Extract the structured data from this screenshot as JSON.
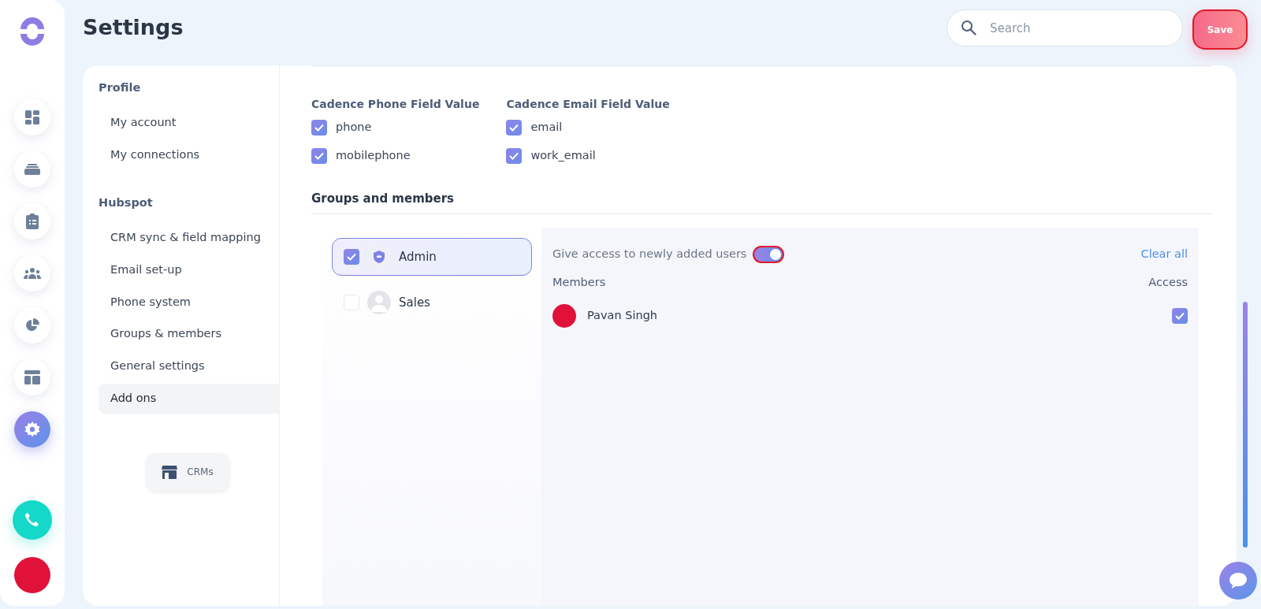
{
  "rail": {
    "items": [
      {
        "kind": "dashboard",
        "selected": false
      },
      {
        "kind": "inbox",
        "selected": false
      },
      {
        "kind": "clipboard",
        "selected": false
      },
      {
        "kind": "people",
        "selected": false
      },
      {
        "kind": "pie",
        "selected": false
      },
      {
        "kind": "layout",
        "selected": false
      },
      {
        "kind": "settings",
        "selected": true
      }
    ]
  },
  "header": {
    "title": "Settings",
    "search": {
      "placeholder": "Search"
    },
    "save_button": "Save"
  },
  "settings_nav": {
    "sections": [
      {
        "title": "Profile",
        "items": [
          {
            "label": "My account",
            "selected": false
          },
          {
            "label": "My connections",
            "selected": false
          }
        ]
      },
      {
        "title": "Hubspot",
        "items": [
          {
            "label": "CRM sync & field mapping",
            "selected": false
          },
          {
            "label": "Email set-up",
            "selected": false
          },
          {
            "label": "Phone system",
            "selected": false
          },
          {
            "label": "Groups & members",
            "selected": false
          },
          {
            "label": "General settings",
            "selected": false
          },
          {
            "label": "Add ons",
            "selected": true
          }
        ]
      }
    ],
    "crms_button": "CRMs"
  },
  "field_values": [
    {
      "title": "Cadence Phone Field Value",
      "options": [
        {
          "label": "phone",
          "checked": true
        },
        {
          "label": "mobilephone",
          "checked": true
        }
      ]
    },
    {
      "title": "Cadence Email Field Value",
      "options": [
        {
          "label": "email",
          "checked": true
        },
        {
          "label": "work_email",
          "checked": true
        }
      ]
    }
  ],
  "groups_section": {
    "title": "Groups and members",
    "groups": [
      {
        "name": "Admin",
        "kind": "shield",
        "checked": true,
        "selected": true
      },
      {
        "name": "Sales",
        "kind": "person",
        "checked": false,
        "selected": false
      }
    ],
    "access_toggle": {
      "label": "Give access to newly added users",
      "on": true
    },
    "clear_all": "Clear all",
    "columns": [
      "Members",
      "Access"
    ],
    "members": [
      {
        "name": "Pavan Singh",
        "access": true
      }
    ]
  }
}
